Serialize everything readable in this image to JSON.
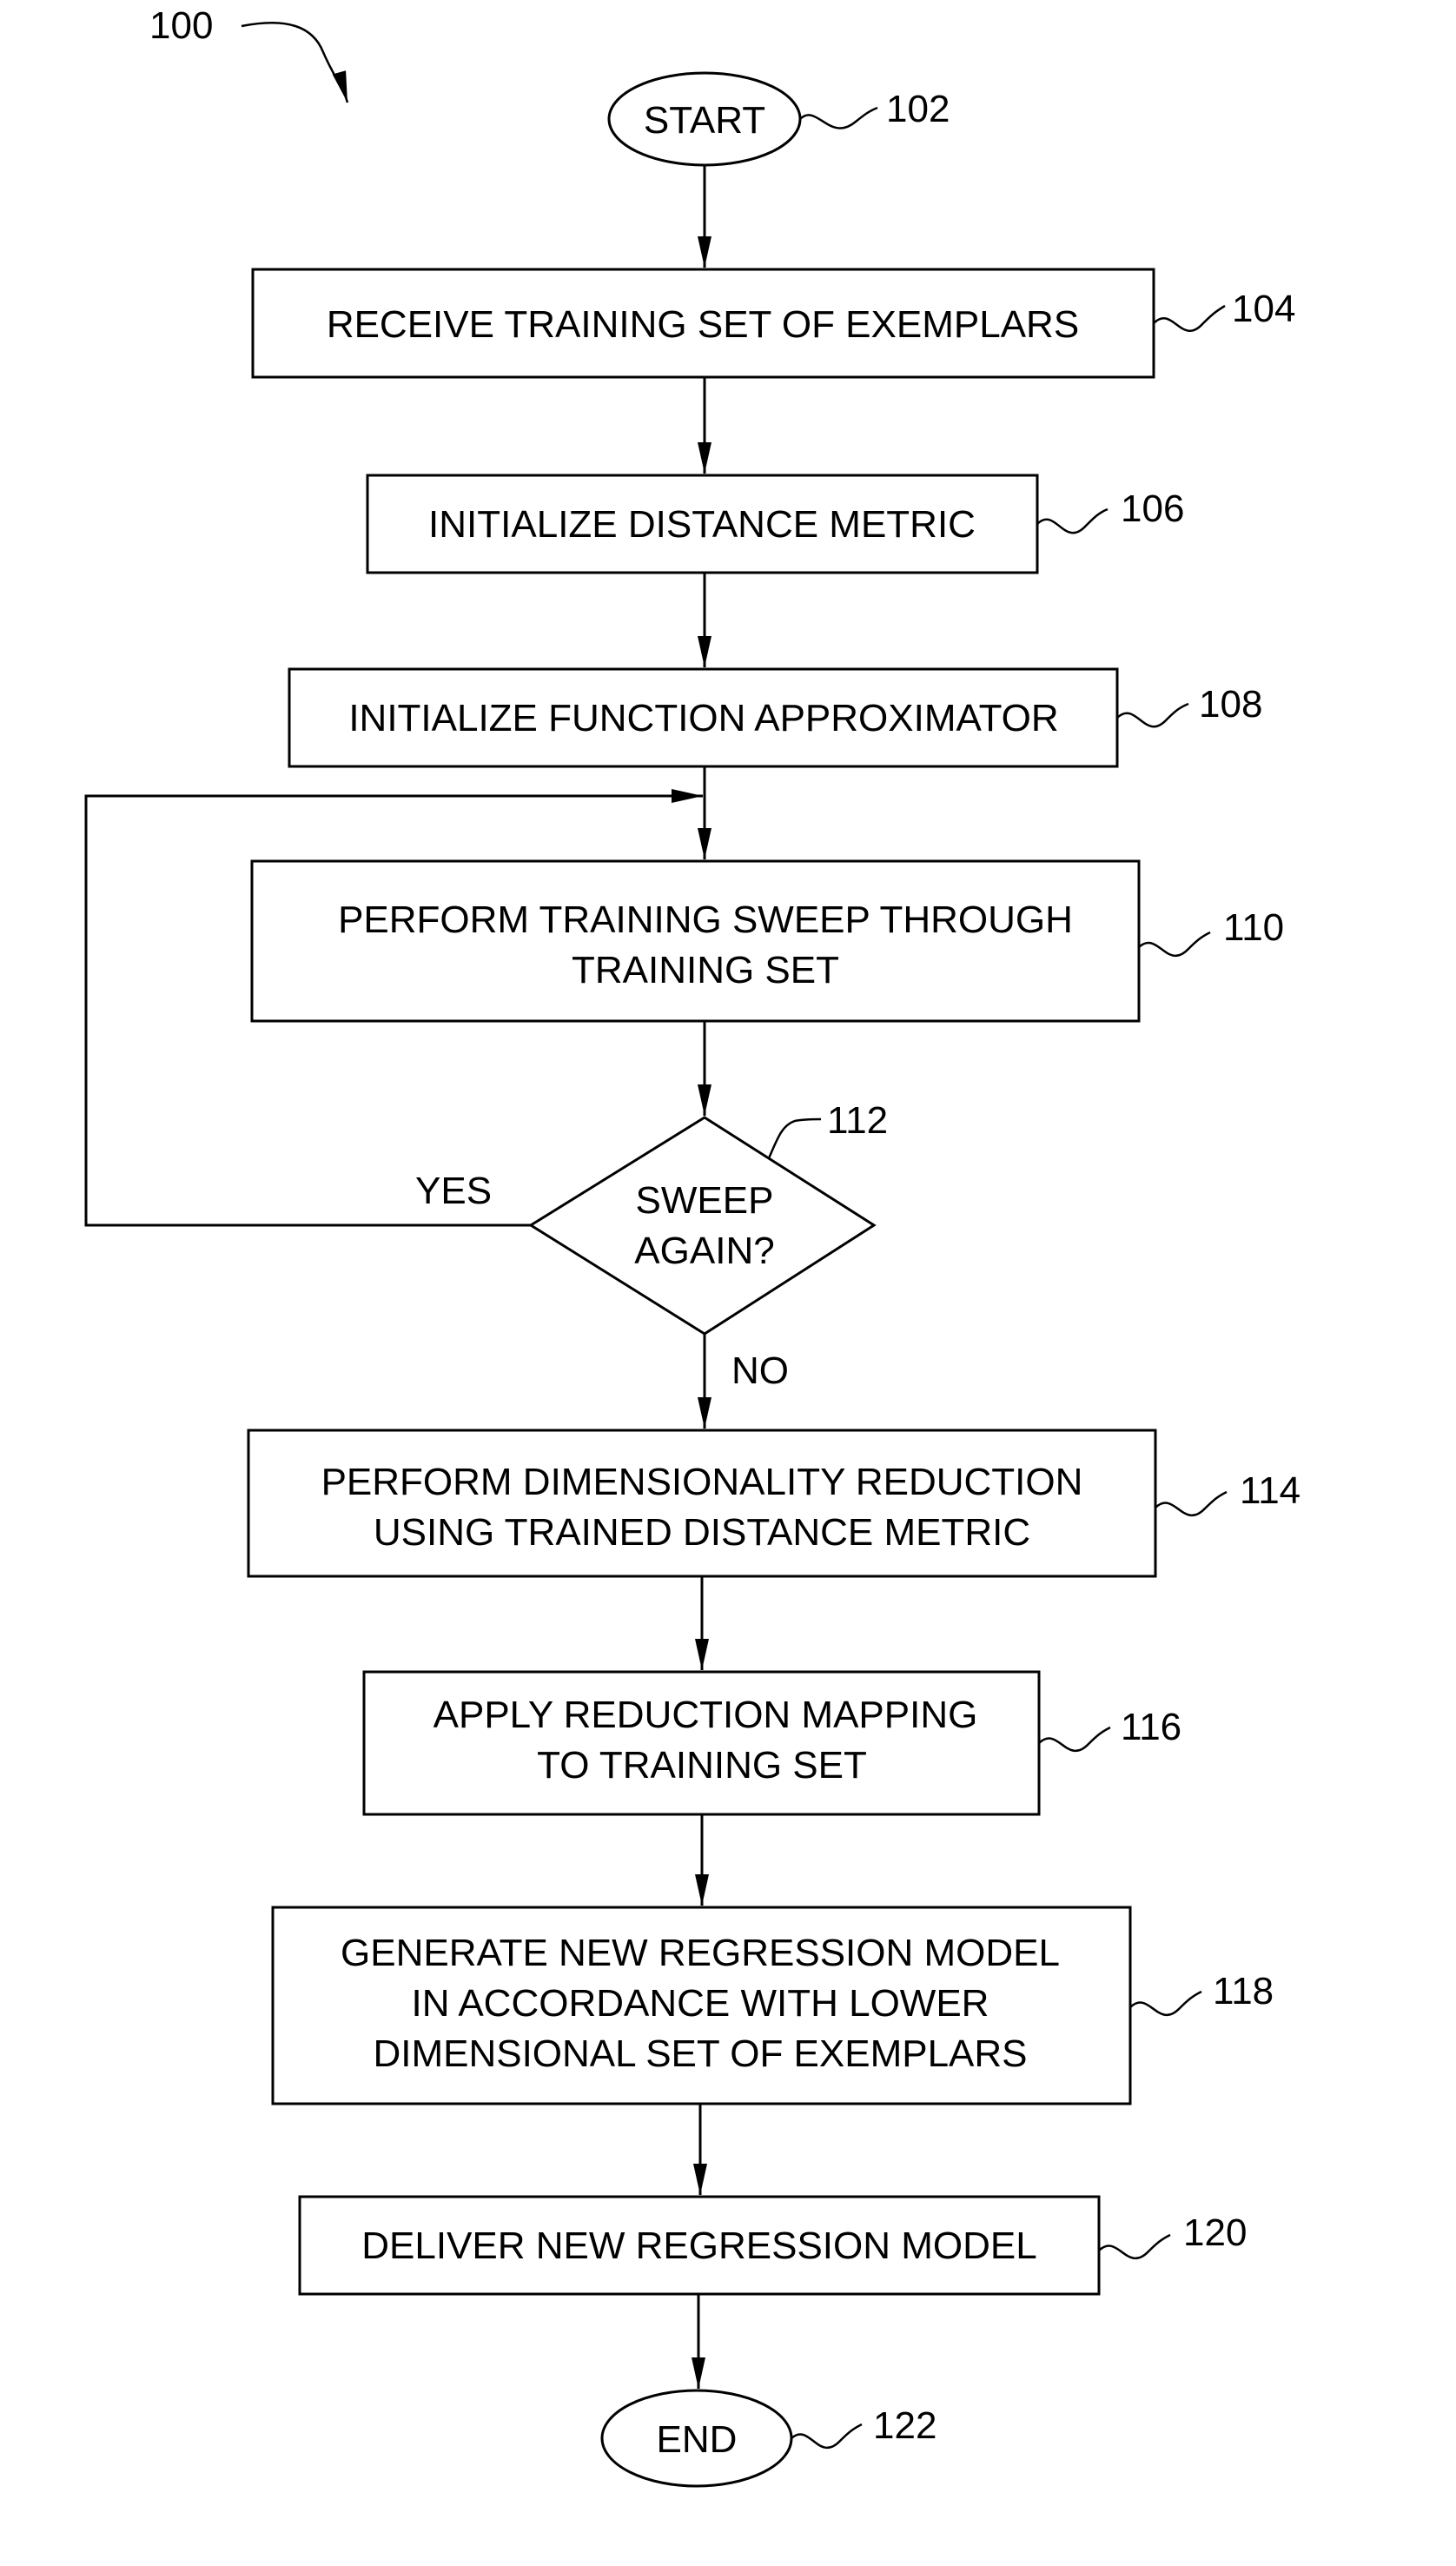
{
  "figure": {
    "ref": "100"
  },
  "nodes": [
    {
      "id": "start",
      "type": "terminal",
      "ref": "102",
      "lines": [
        "START"
      ]
    },
    {
      "id": "receive",
      "type": "process",
      "ref": "104",
      "lines": [
        "RECEIVE TRAINING SET OF EXEMPLARS"
      ]
    },
    {
      "id": "init-metric",
      "type": "process",
      "ref": "106",
      "lines": [
        "INITIALIZE DISTANCE METRIC"
      ]
    },
    {
      "id": "init-approx",
      "type": "process",
      "ref": "108",
      "lines": [
        "INITIALIZE FUNCTION APPROXIMATOR"
      ]
    },
    {
      "id": "sweep",
      "type": "process",
      "ref": "110",
      "lines": [
        "PERFORM TRAINING SWEEP THROUGH",
        "TRAINING SET"
      ]
    },
    {
      "id": "decision",
      "type": "decision",
      "ref": "112",
      "lines": [
        "SWEEP",
        "AGAIN?"
      ]
    },
    {
      "id": "reduce",
      "type": "process",
      "ref": "114",
      "lines": [
        "PERFORM DIMENSIONALITY REDUCTION",
        "USING TRAINED DISTANCE METRIC"
      ]
    },
    {
      "id": "apply",
      "type": "process",
      "ref": "116",
      "lines": [
        "APPLY REDUCTION MAPPING",
        "TO TRAINING SET"
      ]
    },
    {
      "id": "generate",
      "type": "process",
      "ref": "118",
      "lines": [
        "GENERATE NEW REGRESSION MODEL",
        "IN ACCORDANCE WITH LOWER",
        "DIMENSIONAL SET OF EXEMPLARS"
      ]
    },
    {
      "id": "deliver",
      "type": "process",
      "ref": "120",
      "lines": [
        "DELIVER NEW REGRESSION MODEL"
      ]
    },
    {
      "id": "end",
      "type": "terminal",
      "ref": "122",
      "lines": [
        "END"
      ]
    }
  ],
  "edges": [
    {
      "from": "start",
      "to": "receive",
      "label": ""
    },
    {
      "from": "receive",
      "to": "init-metric",
      "label": ""
    },
    {
      "from": "init-metric",
      "to": "init-approx",
      "label": ""
    },
    {
      "from": "init-approx",
      "to": "sweep",
      "label": ""
    },
    {
      "from": "sweep",
      "to": "decision",
      "label": ""
    },
    {
      "from": "decision",
      "to": "sweep",
      "label": "YES"
    },
    {
      "from": "decision",
      "to": "reduce",
      "label": "NO"
    },
    {
      "from": "reduce",
      "to": "apply",
      "label": ""
    },
    {
      "from": "apply",
      "to": "generate",
      "label": ""
    },
    {
      "from": "generate",
      "to": "deliver",
      "label": ""
    },
    {
      "from": "deliver",
      "to": "end",
      "label": ""
    }
  ],
  "labels": {
    "yes": "YES",
    "no": "NO"
  }
}
